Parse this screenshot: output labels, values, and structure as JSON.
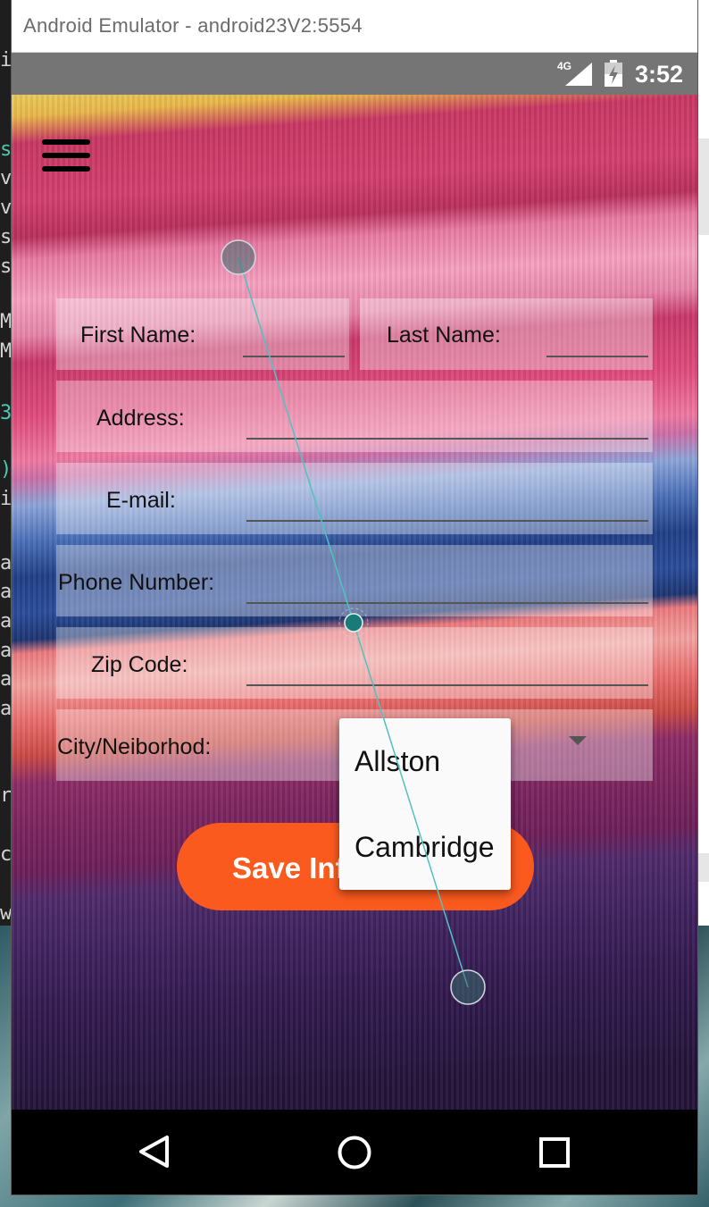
{
  "window": {
    "title": "Android Emulator - android23V2:5554"
  },
  "status_bar": {
    "network": "4G",
    "time": "3:52"
  },
  "form": {
    "first_name": {
      "label": "First Name:",
      "value": ""
    },
    "last_name": {
      "label": "Last Name:",
      "value": ""
    },
    "address": {
      "label": "Address:",
      "value": ""
    },
    "email": {
      "label": "E-mail:",
      "value": ""
    },
    "phone": {
      "label": "Phone Number:",
      "value": ""
    },
    "zip": {
      "label": "Zip Code:",
      "value": ""
    },
    "city": {
      "label": "City/Neiborhod:"
    }
  },
  "dropdown": {
    "options": [
      "Allston",
      "Cambridge"
    ]
  },
  "save_button": {
    "label": "Save Info"
  },
  "colors": {
    "accent": "#fb5a1f",
    "status_bar": "#757575",
    "touch_trace": "#4fc3c0"
  },
  "icons": {
    "menu": "hamburger-menu-icon",
    "back": "back-triangle-icon",
    "home": "home-circle-icon",
    "recents": "recents-square-icon"
  },
  "background_code_fragments": [
    "i",
    "s",
    "v",
    "v",
    "s",
    "s",
    "M",
    "M",
    "3",
    ")",
    "i",
    "a",
    "a",
    "a",
    "a",
    "a",
    "a",
    "r",
    "c",
    "w"
  ]
}
